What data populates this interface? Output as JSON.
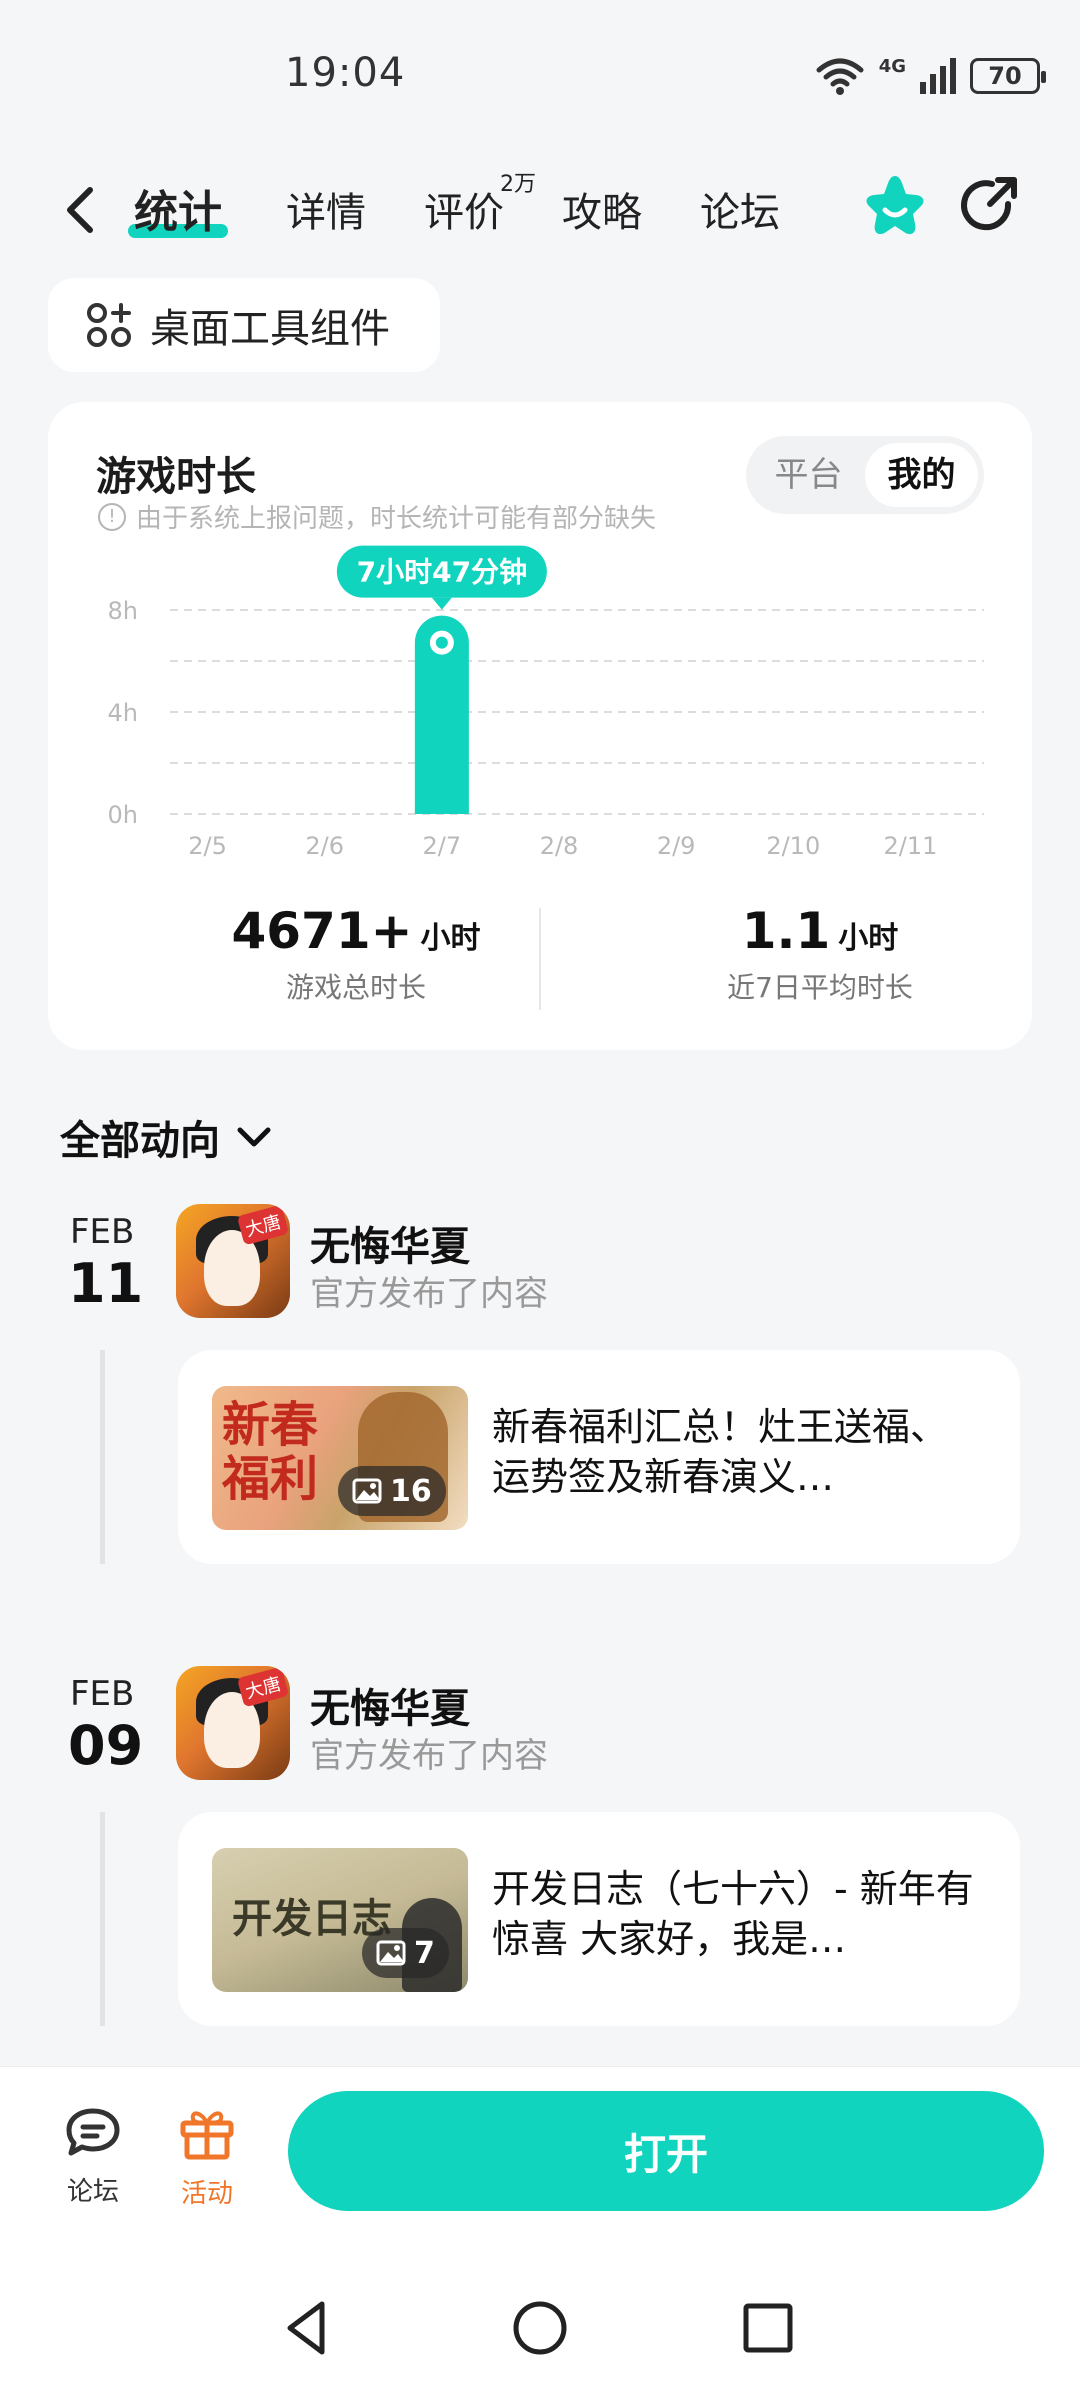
{
  "status_bar": {
    "time": "19:04",
    "network": "4G",
    "battery": "70"
  },
  "nav": {
    "tabs": [
      {
        "label": "统计",
        "active": true
      },
      {
        "label": "详情",
        "active": false
      },
      {
        "label": "评价",
        "active": false
      },
      {
        "label": "攻略",
        "active": false
      },
      {
        "label": "论坛",
        "active": false
      }
    ],
    "review_badge": "2万",
    "accent_color": "#10d4bd"
  },
  "widget_button": {
    "label": "桌面工具组件",
    "icon": "grid-add-icon"
  },
  "stats": {
    "title": "游戏时长",
    "note": "由于系统上报问题，时长统计可能有部分缺失",
    "toggle": {
      "options": [
        "平台",
        "我的"
      ],
      "selected": "我的"
    },
    "total_value": "4671+",
    "total_unit": "小时",
    "total_label": "游戏总时长",
    "avg_value": "1.1",
    "avg_unit": "小时",
    "avg_label": "近7日平均时长"
  },
  "chart_data": {
    "type": "bar",
    "categories": [
      "2/5",
      "2/6",
      "2/7",
      "2/8",
      "2/9",
      "2/10",
      "2/11"
    ],
    "values": [
      0,
      0,
      7.78,
      0,
      0,
      0,
      0
    ],
    "ylim": [
      0,
      8
    ],
    "yticks": [
      "0h",
      "4h",
      "8h"
    ],
    "highlight_label": "7小时47分钟",
    "highlight_index": 2,
    "grid": true,
    "color": "#10d4bd"
  },
  "feed": {
    "header": "全部动向",
    "items": [
      {
        "month": "FEB",
        "day": "11",
        "app_name": "无悔华夏",
        "app_sub": "官方发布了内容",
        "thumb_text": "新春福利",
        "image_count": "16",
        "post_title": "新春福利汇总！灶王送福、运势签及新春演义…"
      },
      {
        "month": "FEB",
        "day": "09",
        "app_name": "无悔华夏",
        "app_sub": "官方发布了内容",
        "thumb_text": "开发日志",
        "image_count": "7",
        "post_title": "开发日志（七十六）- 新年有惊喜 大家好，我是…"
      }
    ]
  },
  "bottom_bar": {
    "forum_label": "论坛",
    "activity_label": "活动",
    "activity_color": "#f0762a",
    "open_label": "打开"
  }
}
